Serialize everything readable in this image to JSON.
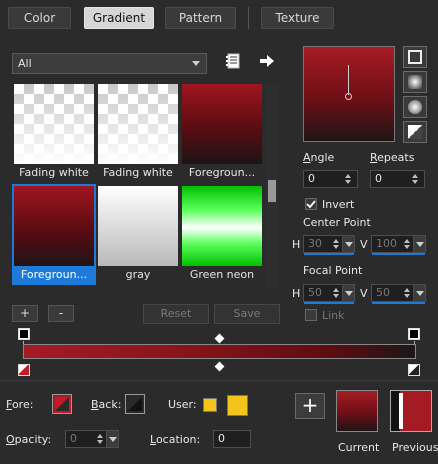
{
  "tabs": [
    {
      "label": "Color",
      "active": false
    },
    {
      "label": "Gradient",
      "active": true
    },
    {
      "label": "Pattern",
      "active": false
    },
    {
      "label": "Texture",
      "active": false
    }
  ],
  "filter": {
    "selected": "All"
  },
  "swatches": [
    {
      "label": "Fading white",
      "style": "checker-fade"
    },
    {
      "label": "Fading white",
      "style": "checker-fade"
    },
    {
      "label": "Foregroun...",
      "style": "fg"
    },
    {
      "label": "Foregroun...",
      "style": "fg",
      "selected": true
    },
    {
      "label": "gray",
      "style": "gray"
    },
    {
      "label": "Green neon",
      "style": "neon"
    }
  ],
  "list_buttons": {
    "add": "+",
    "remove": "-",
    "reset": "Reset",
    "save": "Save"
  },
  "angle": {
    "label": "Angle",
    "value": "0"
  },
  "repeats": {
    "label": "Repeats",
    "value": "0"
  },
  "invert": {
    "label": "Invert",
    "checked": true
  },
  "center_point": {
    "label": "Center Point",
    "h_label": "H",
    "h_value": "30",
    "v_label": "V",
    "v_value": "100"
  },
  "focal_point": {
    "label": "Focal Point",
    "h_label": "H",
    "h_value": "50",
    "v_label": "V",
    "v_value": "50"
  },
  "link": {
    "label": "Link"
  },
  "fore": {
    "label": "Fore:"
  },
  "back": {
    "label": "Back:"
  },
  "user": {
    "label": "User:",
    "color": "#f3c41b"
  },
  "opacity": {
    "label": "Opacity:",
    "value": "0"
  },
  "location": {
    "label": "Location:",
    "value": "0"
  },
  "current_label": "Current",
  "previous_label": "Previous",
  "colors": {
    "gradient_start": "#a51b24",
    "gradient_end": "#1c1718",
    "accent": "#1e7ad8",
    "neon": "#00c000"
  }
}
